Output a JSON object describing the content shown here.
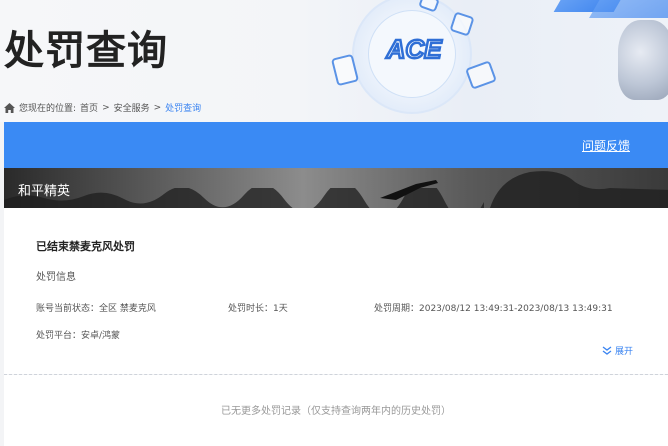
{
  "header": {
    "title": "处罚查询",
    "logo_text": "ACE"
  },
  "breadcrumb": {
    "prefix": "您现在的位置:",
    "items": [
      "首页",
      "安全服务"
    ],
    "separator": ">",
    "current": "处罚查询"
  },
  "toolbar": {
    "feedback_label": "问题反馈"
  },
  "game": {
    "name": "和平精英"
  },
  "record": {
    "title": "已结束禁麦克风处罚",
    "section": "处罚信息",
    "status": "账号当前状态：全区 禁麦克风",
    "duration": "处罚时长：1天",
    "period": "处罚周期：2023/08/12 13:49:31-2023/08/13 13:49:31",
    "platform": "处罚平台：安卓/鸿蒙",
    "expand_label": "展开"
  },
  "footer": {
    "no_more": "已无更多处罚记录（仅支持查询两年内的历史处罚）"
  },
  "colors": {
    "accent": "#3a8af4",
    "link": "#3a84f1",
    "title": "#222222"
  }
}
